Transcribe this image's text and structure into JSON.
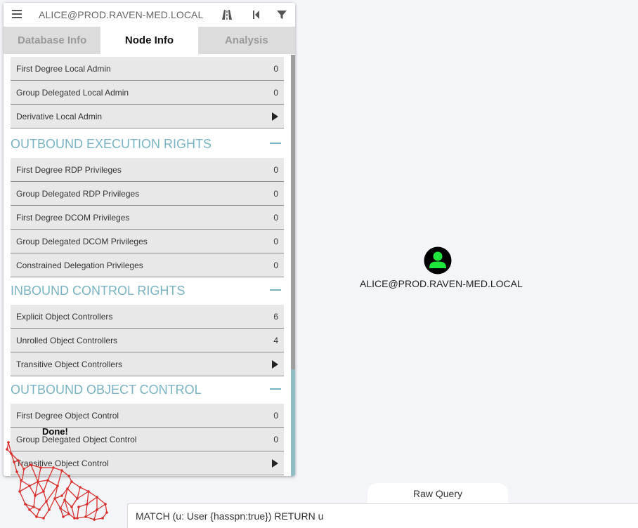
{
  "search": {
    "value": "ALICE@PROD.RAVEN-MED.LOCAL"
  },
  "tabs": [
    {
      "label": "Database Info",
      "active": false
    },
    {
      "label": "Node Info",
      "active": true
    },
    {
      "label": "Analysis",
      "active": false
    }
  ],
  "rows_top": [
    {
      "label": "First Degree Local Admin",
      "value": "0"
    },
    {
      "label": "Group Delegated Local Admin",
      "value": "0"
    },
    {
      "label": "Derivative Local Admin",
      "value": null
    }
  ],
  "sections": [
    {
      "title": "OUTBOUND EXECUTION RIGHTS",
      "rows": [
        {
          "label": "First Degree RDP Privileges",
          "value": "0"
        },
        {
          "label": "Group Delegated RDP Privileges",
          "value": "0"
        },
        {
          "label": "First Degree DCOM Privileges",
          "value": "0"
        },
        {
          "label": "Group Delegated DCOM Privileges",
          "value": "0"
        },
        {
          "label": "Constrained Delegation Privileges",
          "value": "0"
        }
      ]
    },
    {
      "title": "INBOUND CONTROL RIGHTS",
      "rows": [
        {
          "label": "Explicit Object Controllers",
          "value": "6"
        },
        {
          "label": "Unrolled Object Controllers",
          "value": "4"
        },
        {
          "label": "Transitive Object Controllers",
          "value": null
        }
      ]
    },
    {
      "title": "OUTBOUND OBJECT CONTROL",
      "rows": [
        {
          "label": "First Degree Object Control",
          "value": "0"
        },
        {
          "label": "Group Delegated Object Control",
          "value": "0"
        },
        {
          "label": "Transitive Object Control",
          "value": null
        }
      ]
    }
  ],
  "graph": {
    "node_label": "ALICE@PROD.RAVEN-MED.LOCAL",
    "node_color": "#1ee63c"
  },
  "status": {
    "done_text": "Done!"
  },
  "raw_query": {
    "tab_label": "Raw Query",
    "value": "MATCH (u: User {hasspn:true}) RETURN u"
  },
  "colors": {
    "section_title": "#7ab3c3",
    "row_bg": "#e8e8e8",
    "logo_red": "#d9302c"
  },
  "icons": {
    "menu": "hamburger-icon",
    "pathfinding": "road-icon",
    "back": "step-back-icon",
    "filter": "filter-icon",
    "expand": "play-arrow-icon",
    "collapse": "minus-icon",
    "node": "user-icon"
  }
}
